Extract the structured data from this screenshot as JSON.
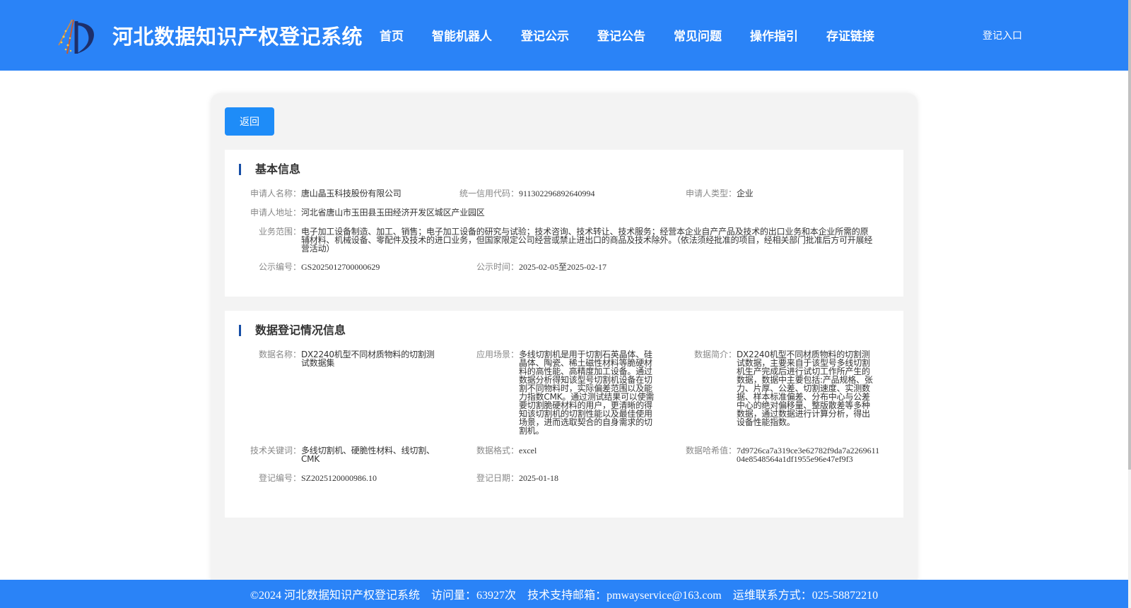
{
  "header": {
    "title": "河北数据知识产权登记系统",
    "nav": [
      "首页",
      "智能机器人",
      "登记公示",
      "登记公告",
      "常见问题",
      "操作指引",
      "存证链接"
    ],
    "login": "登记入口"
  },
  "actions": {
    "back": "返回"
  },
  "basic": {
    "title": "基本信息",
    "applicant_name_label": "申请人名称：",
    "applicant_name": "唐山晶玉科技股份有限公司",
    "credit_code_label": "统一信用代码：",
    "credit_code": "911302296892640994",
    "applicant_type_label": "申请人类型：",
    "applicant_type": "企业",
    "address_label": "申请人地址：",
    "address": "河北省唐山市玉田县玉田经济开发区城区产业园区",
    "scope_label": "业务范围：",
    "scope": "电子加工设备制造、加工、销售；电子加工设备的研究与试验；技术咨询、技术转让、技术服务；经营本企业自产产品及技术的出口业务和本企业所需的原辅材料、机械设备、零配件及技术的进口业务，但国家限定公司经营或禁止进出口的商品及技术除外。（依法须经批准的项目，经相关部门批准后方可开展经营活动）",
    "notice_no_label": "公示编号：",
    "notice_no": "GS2025012700000629",
    "notice_time_label": "公示时间：",
    "notice_time": "2025-02-05至2025-02-17"
  },
  "data": {
    "title": "数据登记情况信息",
    "name_label": "数据名称：",
    "name": "DX2240机型不同材质物料的切割测试数据集",
    "scenario_label": "应用场景：",
    "scenario": "多线切割机是用于切割石英晶体、硅晶体、陶瓷、稀土磁性材料等脆硬材料的高性能、高精度加工设备。通过数据分析得知该型号切割机设备在切割不同物料时，实际偏差范围以及能力指数CMK。通过测试结果可以使需要切割脆硬材料的用户，更清晰的得知该切割机的切割性能以及最佳使用场景，进而选取契合的自身需求的切割机。",
    "intro_label": "数据简介：",
    "intro": "DX2240机型不同材质物料的切割测试数据，主要来自于该型号多线切割机生产完成后进行试切工作所产生的数据，数据中主要包括:产品规格、张力、片厚、公差、切割速度、实测数据、样本标准偏差、分布中心与公差中心的绝对偏移量、整版散差等多种数据，通过数据进行计算分析，得出设备性能指数。",
    "keywords_label": "技术关键词：",
    "keywords": "多线切割机、硬脆性材料、线切割、CMK",
    "format_label": "数据格式：",
    "format": "excel",
    "hash_label": "数据哈希值：",
    "hash": "7d9726ca7a319ce3e62782f9da7a226961104e8548564a1df1955e96e47ef9f3",
    "reg_no_label": "登记编号：",
    "reg_no": "SZ2025120000986.10",
    "reg_date_label": "登记日期：",
    "reg_date": "2025-01-18"
  },
  "footer": {
    "copyright": "©2024 河北数据知识产权登记系统",
    "visits": "访问量：63927次",
    "email": "技术支持邮箱：pmwayservice@163.com",
    "phone": "运维联系方式：025-58872210"
  },
  "colors": {
    "header_bg": "#2a83f7",
    "button_bg": "#1e8cf8",
    "section_bar": "#174ea6"
  }
}
